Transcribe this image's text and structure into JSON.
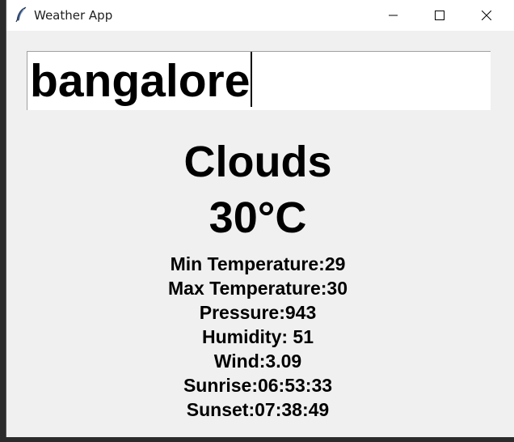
{
  "window": {
    "title": "Weather App",
    "controls": [
      "minimize-icon",
      "maximize-icon",
      "close-icon"
    ]
  },
  "search": {
    "value": "bangalore"
  },
  "weather": {
    "condition": "Clouds",
    "temperature": "30°C",
    "details": {
      "min_temp": "Min Temperature:29",
      "max_temp": "Max Temperature:30",
      "pressure": "Pressure:943",
      "humidity": "Humidity: 51",
      "wind": "Wind:3.09",
      "sunrise": "Sunrise:06:53:33",
      "sunset": "Sunset:07:38:49"
    }
  },
  "colors": {
    "background": "#f0f0f0",
    "titlebar": "#ffffff",
    "text": "#000000"
  }
}
